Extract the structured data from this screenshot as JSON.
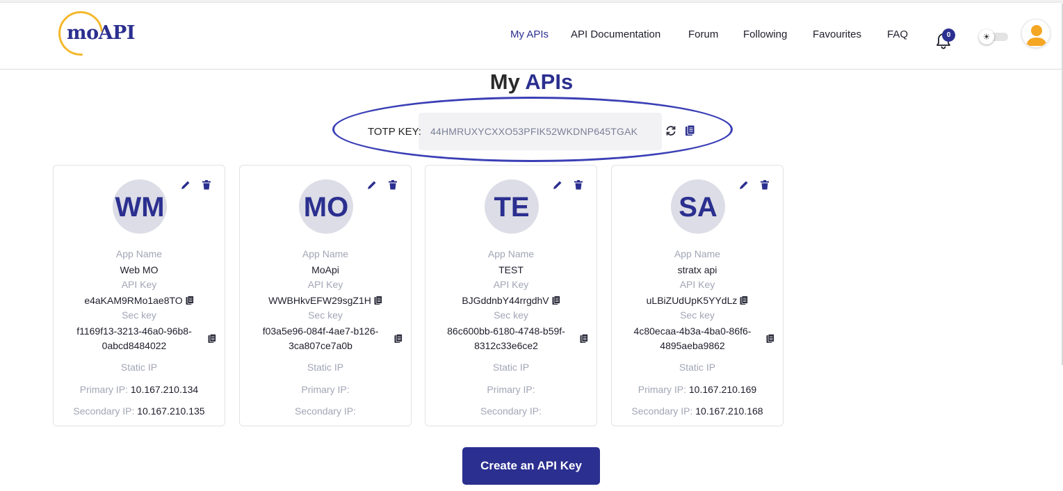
{
  "header": {
    "logo_text": "moAPI",
    "nav": [
      {
        "label": "My APIs",
        "active": true
      },
      {
        "label": "API Documentation",
        "active": false
      },
      {
        "label": "Forum",
        "active": false
      },
      {
        "label": "Following",
        "active": false
      },
      {
        "label": "Favourites",
        "active": false
      },
      {
        "label": "FAQ",
        "active": false
      }
    ],
    "notifications_count": "0",
    "icons": {
      "bell": "bell-icon",
      "theme": "sun-icon",
      "user": "user-avatar-icon"
    }
  },
  "page": {
    "title_dark": "My ",
    "title_accent": "APIs"
  },
  "totp": {
    "label": "TOTP KEY:",
    "value": "44HMRUXYCXXO53PFIK52WKDNP645TGAK",
    "icons": [
      "refresh-icon",
      "copy-icon"
    ]
  },
  "labels": {
    "app_name": "App Name",
    "api_key": "API Key",
    "sec_key": "Sec key",
    "static_ip": "Static IP",
    "primary_ip": "Primary IP:",
    "secondary_ip": "Secondary IP:"
  },
  "cards": [
    {
      "initials": "WM",
      "app_name": "Web MO",
      "api_key": "e4aKAM9RMo1ae8TO",
      "sec_key": "f1169f13-3213-46a0-96b8-0abcd8484022",
      "primary_ip": "10.167.210.134",
      "secondary_ip": "10.167.210.135"
    },
    {
      "initials": "MO",
      "app_name": "MoApi",
      "api_key": "WWBHkvEFW29sgZ1H",
      "sec_key": "f03a5e96-084f-4ae7-b126-3ca807ce7a0b",
      "primary_ip": "",
      "secondary_ip": ""
    },
    {
      "initials": "TE",
      "app_name": "TEST",
      "api_key": "BJGddnbY44rrgdhV",
      "sec_key": "86c600bb-6180-4748-b59f-8312c33e6ce2",
      "primary_ip": "",
      "secondary_ip": ""
    },
    {
      "initials": "SA",
      "app_name": "stratx api",
      "api_key": "uLBiZUdUpK5YYdLz",
      "sec_key": "4c80ecaa-4b3a-4ba0-86f6-4895aeba9862",
      "primary_ip": "10.167.210.169",
      "secondary_ip": "10.167.210.168"
    }
  ],
  "actions": {
    "create_label": "Create an API Key"
  },
  "colors": {
    "brand": "#2b2f8f",
    "logo_ring": "#f4b82b",
    "annotation": "#3a3fb5"
  }
}
